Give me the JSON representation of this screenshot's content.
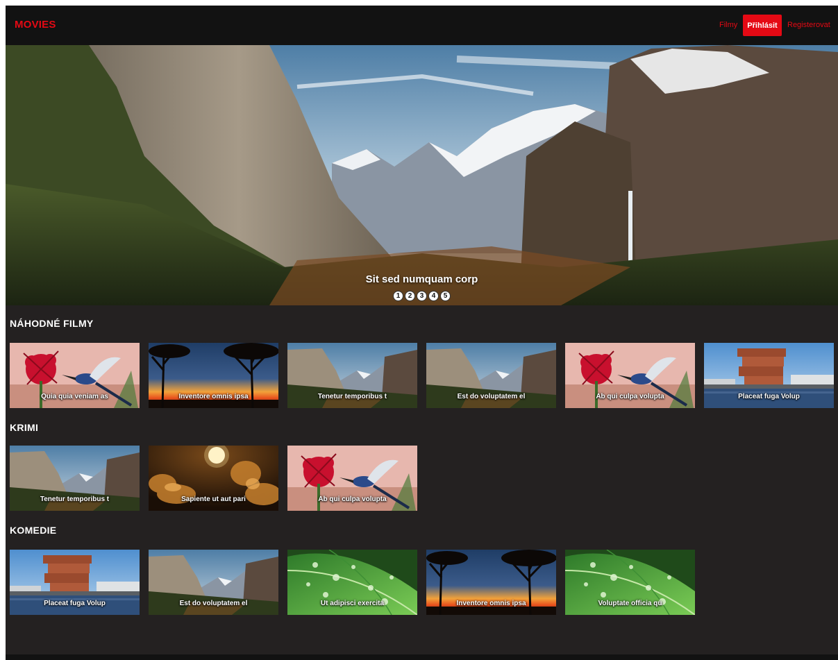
{
  "nav": {
    "brand": "MOVIES",
    "films": "Filmy",
    "login": "Přihlásit",
    "register": "Registerovat"
  },
  "hero": {
    "caption": "Sit sed numquam corp",
    "dots": [
      "1",
      "2",
      "3",
      "4",
      "5"
    ]
  },
  "sections": [
    {
      "title": "NÁHODNÉ FILMY",
      "cards": [
        {
          "label": "Quia quia veniam as",
          "image": "hummingbird"
        },
        {
          "label": "Inventore omnis ipsa",
          "image": "sunset"
        },
        {
          "label": "Tenetur temporibus t",
          "image": "mountains"
        },
        {
          "label": "Est do voluptatem el",
          "image": "mountains"
        },
        {
          "label": "Ab qui culpa volupta",
          "image": "hummingbird"
        },
        {
          "label": "Placeat fuga Volup",
          "image": "building"
        }
      ]
    },
    {
      "title": "KRIMI",
      "cards": [
        {
          "label": "Tenetur temporibus t",
          "image": "mountains"
        },
        {
          "label": "Sapiente ut aut pari",
          "image": "moon"
        },
        {
          "label": "Ab qui culpa volupta",
          "image": "hummingbird"
        }
      ]
    },
    {
      "title": "KOMEDIE",
      "cards": [
        {
          "label": "Placeat fuga Volup",
          "image": "building"
        },
        {
          "label": "Est do voluptatem el",
          "image": "mountains"
        },
        {
          "label": "Ut adipisci exercita",
          "image": "leaf"
        },
        {
          "label": "Inventore omnis ipsa",
          "image": "sunset"
        },
        {
          "label": "Voluptate officia qu",
          "image": "leaf"
        }
      ]
    }
  ]
}
